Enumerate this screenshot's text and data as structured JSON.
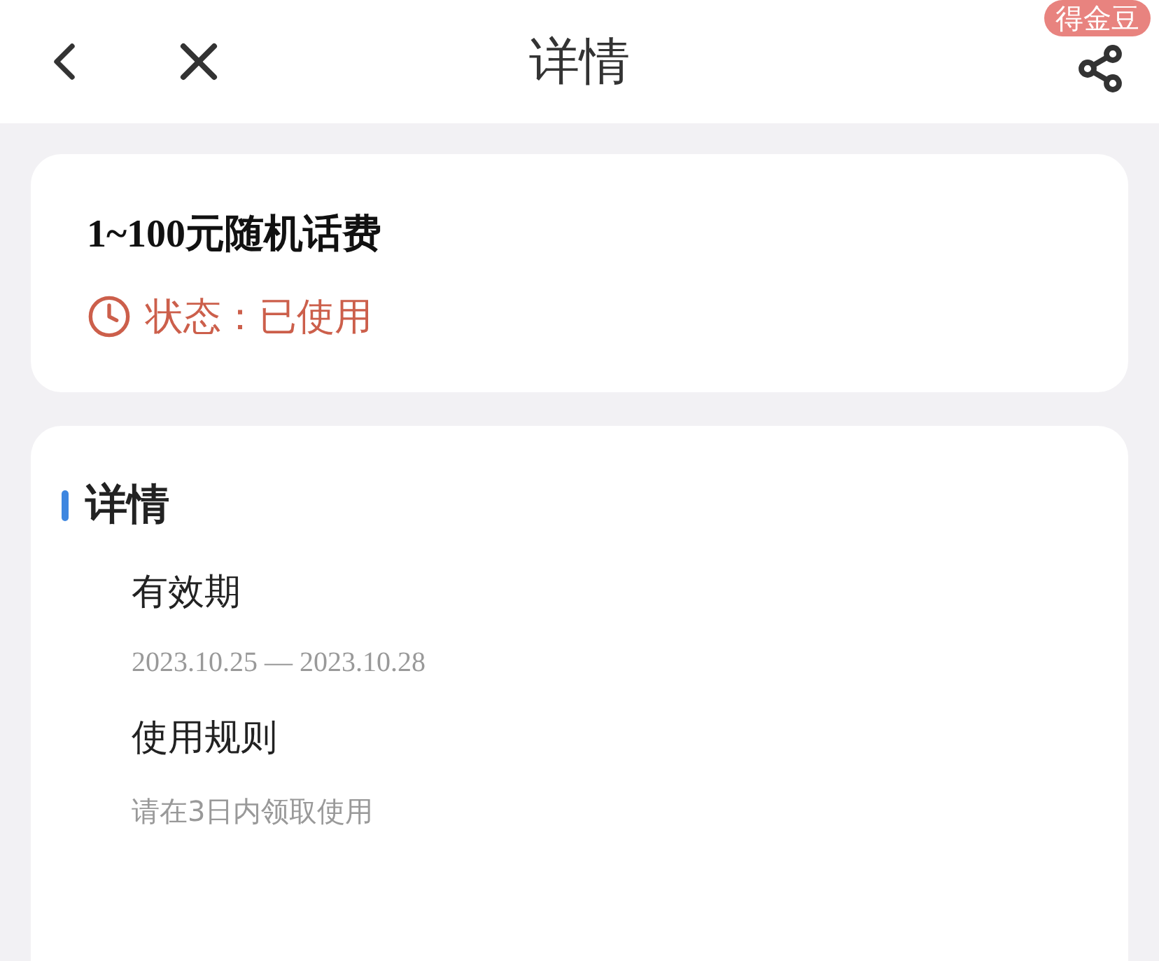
{
  "header": {
    "title": "详情",
    "badge": "得金豆"
  },
  "coupon": {
    "title": "1~100元随机话费",
    "status": "状态：已使用"
  },
  "details": {
    "heading": "详情",
    "sections": [
      {
        "label": "有效期",
        "text": "2023.10.25 — 2023.10.28"
      },
      {
        "label": "使用规则",
        "text": "请在3日内领取使用"
      }
    ]
  }
}
